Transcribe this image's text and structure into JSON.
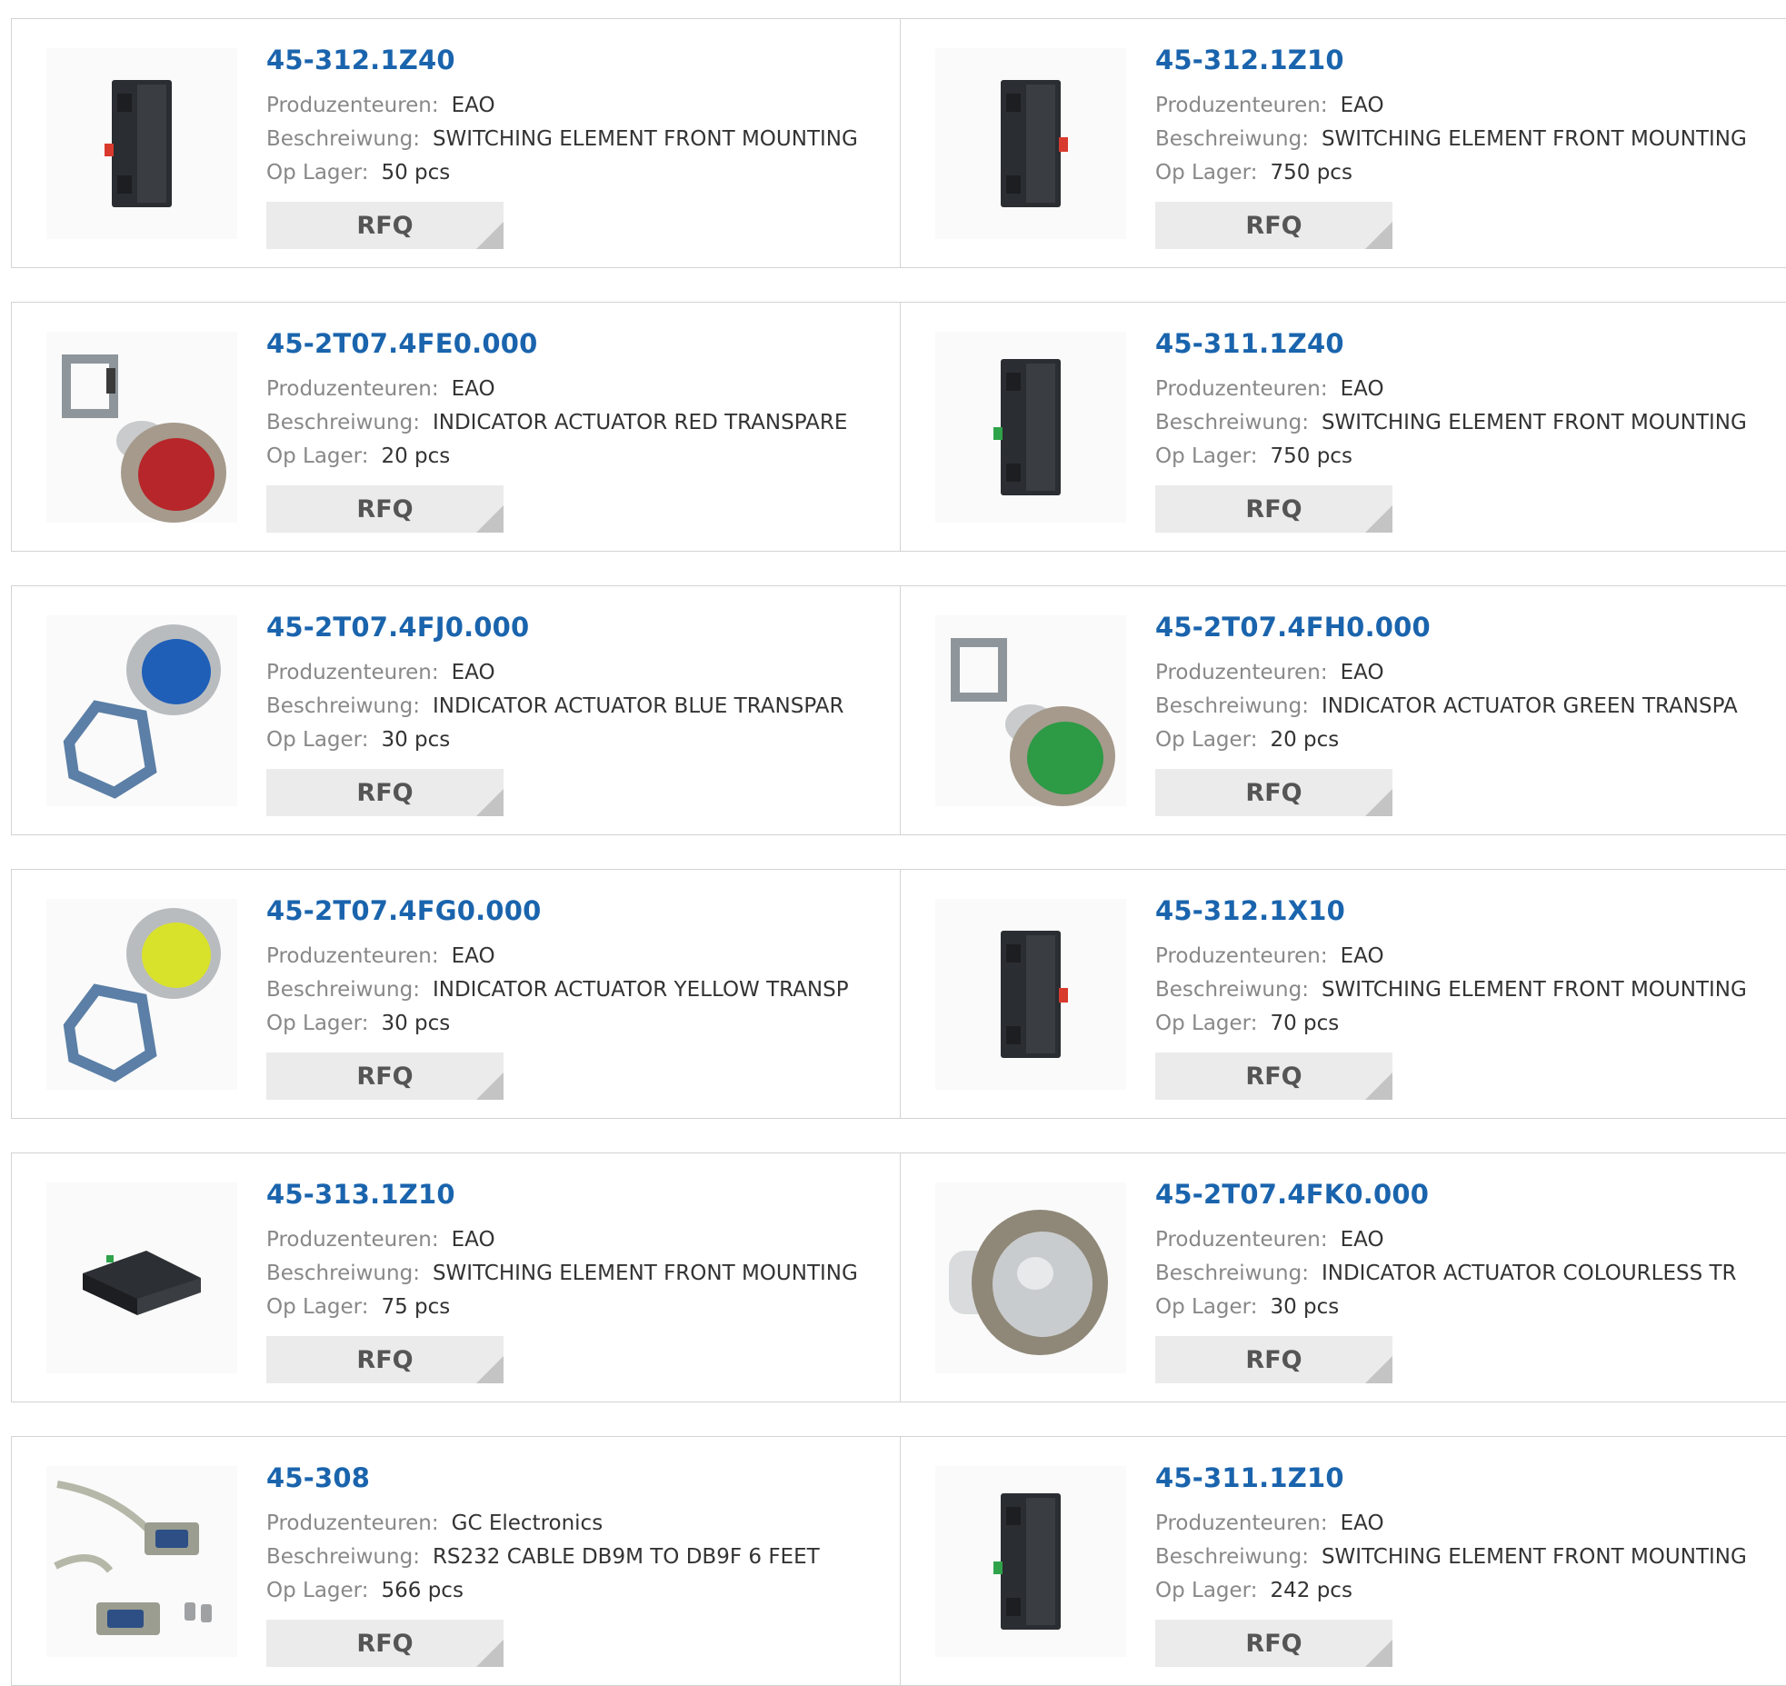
{
  "labels": {
    "manufacturer": "Produzenteuren:",
    "description": "Beschreiwung:",
    "stock": "Op Lager:",
    "rfq": "RFQ"
  },
  "products": [
    {
      "part": "45-312.1Z40",
      "manufacturer": "EAO",
      "description": "SWITCHING ELEMENT FRONT MOUNTING",
      "stock": "50 pcs",
      "image": "switching-element-red"
    },
    {
      "part": "45-312.1Z10",
      "manufacturer": "EAO",
      "description": "SWITCHING ELEMENT FRONT MOUNTING",
      "stock": "750 pcs",
      "image": "switching-element-red"
    },
    {
      "part": "45-2T07.4FE0.000",
      "manufacturer": "EAO",
      "description": "INDICATOR ACTUATOR RED TRANSPARE",
      "stock": "20 pcs",
      "image": "indicator-red"
    },
    {
      "part": "45-311.1Z40",
      "manufacturer": "EAO",
      "description": "SWITCHING ELEMENT FRONT MOUNTING",
      "stock": "750 pcs",
      "image": "switching-element-green"
    },
    {
      "part": "45-2T07.4FJ0.000",
      "manufacturer": "EAO",
      "description": "INDICATOR ACTUATOR BLUE TRANSPAR",
      "stock": "30 pcs",
      "image": "indicator-blue"
    },
    {
      "part": "45-2T07.4FH0.000",
      "manufacturer": "EAO",
      "description": "INDICATOR ACTUATOR GREEN TRANSPA",
      "stock": "20 pcs",
      "image": "indicator-green"
    },
    {
      "part": "45-2T07.4FG0.000",
      "manufacturer": "EAO",
      "description": "INDICATOR ACTUATOR YELLOW TRANSP",
      "stock": "30 pcs",
      "image": "indicator-yellow"
    },
    {
      "part": "45-312.1X10",
      "manufacturer": "EAO",
      "description": "SWITCHING ELEMENT FRONT MOUNTING",
      "stock": "70 pcs",
      "image": "switching-element-red"
    },
    {
      "part": "45-313.1Z10",
      "manufacturer": "EAO",
      "description": "SWITCHING ELEMENT FRONT MOUNTING",
      "stock": "75 pcs",
      "image": "switching-element-flat"
    },
    {
      "part": "45-2T07.4FK0.000",
      "manufacturer": "EAO",
      "description": "INDICATOR ACTUATOR COLOURLESS TR",
      "stock": "30 pcs",
      "image": "indicator-colourless"
    },
    {
      "part": "45-308",
      "manufacturer": "GC Electronics",
      "description": "RS232 CABLE DB9M TO DB9F 6 FEET",
      "stock": "566 pcs",
      "image": "rs232-cable"
    },
    {
      "part": "45-311.1Z10",
      "manufacturer": "EAO",
      "description": "SWITCHING ELEMENT FRONT MOUNTING",
      "stock": "242 pcs",
      "image": "switching-element-green"
    }
  ],
  "colors": {
    "link": "#1a64ad",
    "label": "#888888",
    "value": "#333333",
    "button_bg": "#ebebeb",
    "border": "#d3d3d3"
  }
}
